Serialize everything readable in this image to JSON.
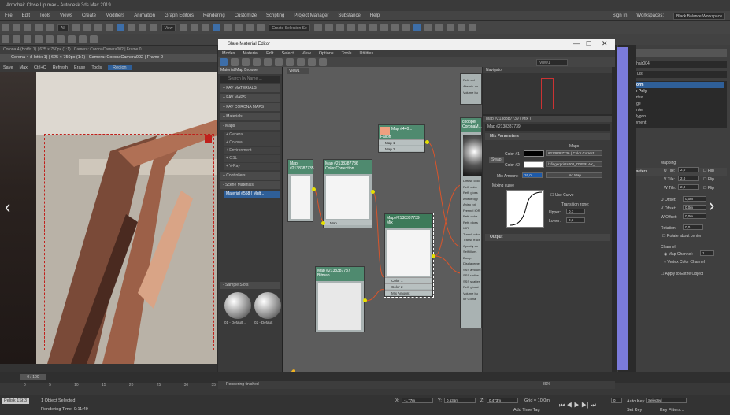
{
  "title": "Armchair Close Up.max - Autodesk 3ds Max 2019",
  "menu": [
    "File",
    "Edit",
    "Tools",
    "Views",
    "Create",
    "Modifiers",
    "Animation",
    "Graph Editors",
    "Rendering",
    "Customize",
    "Scripting",
    "Project Manager",
    "Substance",
    "Help"
  ],
  "signin": "Sign In",
  "workspace_label": "Workspaces:",
  "workspace_value": "Black Balance Workspace",
  "toolbar_all": "All",
  "toolbar_view": "View",
  "create_selection": "Create Selection Se",
  "vfb": {
    "header": "Corona 4 (Hotfix 1) | 625 × 750px (1:1) | Camera: CoronaCamera002 | Frame 0",
    "title": "Corona 4 (Hotfix 1) | 625 × 750px (1:1) | Camera: CoronaCamera002 | Frame 0",
    "save": "Save",
    "max": "Max",
    "ctrlc": "Ctrl+C",
    "refresh": "Refresh",
    "erase": "Erase",
    "tools": "Tools",
    "region": "Region"
  },
  "sme": {
    "title": "Slate Material Editor",
    "menu": [
      "Modes",
      "Material",
      "Edit",
      "Select",
      "View",
      "Options",
      "Tools",
      "Utilities"
    ],
    "view_dropdown": "View1",
    "browser_title": "Material/Map Browser",
    "search": "Search by Name ...",
    "categories": [
      "+ FAV MATERIALS",
      "+ FAV MAPS",
      "+ FAV CORONA MAPS",
      "+ Materials",
      "- Maps"
    ],
    "maps_sub": [
      "+ General",
      "+ Corona",
      "+ Environment",
      "+ OSL",
      "+ V-Ray"
    ],
    "controllers": "+ Controllers",
    "scene_materials": "- Scene Materials",
    "scene_item": "Material #558 ( Mult...",
    "sample_slots": "- Sample Slots",
    "slot1": "01 - Default ...",
    "slot2": "02 - Default",
    "canvas_tab": "View1",
    "rendering_finished": "Rendering finished",
    "zoom": "89%"
  },
  "nodes": {
    "n735": "Map #2138387735",
    "n736_title": "Map #2138387736",
    "n736_sub": "Color Correction",
    "n736_slot": "Map",
    "falloff_title": "Map #440...",
    "falloff_sub": "Falloff",
    "falloff_slots": [
      "Map 1",
      "Map 2"
    ],
    "mix_title": "Map #2138387739",
    "mix_sub": "Mix",
    "mix_slots": [
      "Color 1",
      "Color 2",
      "Mix Amount"
    ],
    "bitmap_title": "Map #2138387737",
    "bitmap_sub": "Bitmap",
    "corona_title": "coopper",
    "corona_sub": "CoronaM...",
    "corona_slots": [
      "Diffuse colo",
      "Refl. color",
      "Refl. gloss",
      "Anisotropy",
      "Aniso rot",
      "Fresnel IOR",
      "Refr. color",
      "Refr. gloss",
      "IOR",
      "Transl. color",
      "Transl. fracti",
      "Opacity co",
      "Self-illum.",
      "Bump",
      "Displaceme",
      "SSS amount",
      "SSS radius",
      "SSS scatter",
      "Refl. glossi",
      "Volume bu",
      "ior Coma"
    ],
    "top_slots": [
      "Refr. col",
      "Absorb. co",
      "Volume bu"
    ]
  },
  "navigator": "Navigator",
  "params": {
    "header": "Map #2138387739 ( Mix )",
    "subheader": "Map #2138387739",
    "mix_parameters": "Mix Parameters",
    "maps_label": "Maps",
    "color1_label": "Color #1",
    "color1_map": "#2138387736 ( Color Correct",
    "color2_label": "Color #2",
    "color2_map": "l:\\fingerprints002_OVERLAY_",
    "swap": "Swap",
    "mix_amount_label": "Mix Amount:",
    "mix_amount_value": "26,0",
    "no_map": "No Map",
    "mixing_curve": "Mixing curve",
    "use_curve": "Use Curve",
    "transition_zone": "Transition zone:",
    "upper_label": "Upper:",
    "upper_value": "0,7",
    "lower_label": "Lower:",
    "lower_value": "0,3",
    "output": "Output"
  },
  "rpanel": {
    "name": "Scoop chair004",
    "modifier_list": "Modifier List",
    "stack": [
      "UVW Xform",
      "Editable Poly",
      "Vertex",
      "Edge",
      "Border",
      "Polygon",
      "Element"
    ],
    "parameters": "Parameters",
    "mapping": "Mapping:",
    "u_tile_label": "U Tile:",
    "u_tile": "2,0",
    "v_tile_label": "V Tile:",
    "v_tile": "2,0",
    "w_tile_label": "W Tile:",
    "w_tile": "2,0",
    "flip": "Flip",
    "u_offset_label": "U Offset:",
    "u_offset": "0,0m",
    "v_offset_label": "V Offset:",
    "v_offset": "0,0m",
    "w_offset_label": "W Offset:",
    "w_offset": "0,0m",
    "rotation_label": "Rotation:",
    "rotation": "0,0",
    "rotate_center": "Rotate about center",
    "channel": "Channel:",
    "map_channel_label": "Map Channel:",
    "map_channel": "1",
    "vertex_color": "Vertex Color Channel",
    "apply_entire": "Apply to Entire Object"
  },
  "timeline": {
    "frame": "0 / 100",
    "ticks": [
      "0",
      "5",
      "10",
      "15",
      "20",
      "25",
      "30",
      "35",
      "40",
      "45",
      "50",
      "55",
      "60",
      "65",
      "70",
      "75",
      "80",
      "85",
      "90",
      "95",
      "100"
    ]
  },
  "bottom": {
    "script": "Pelisk 1St 3",
    "objects": "1 Object Selected",
    "render_time": "Rendering Time: 0:11:49",
    "x_label": "X:",
    "x": "-1,77m",
    "y_label": "Y:",
    "y": "0,536m",
    "z_label": "Z:",
    "z": "0,473m",
    "grid": "Grid = 10,0m",
    "add_time_tag": "Add Time Tag",
    "auto_key": "Auto Key",
    "selected": "Selected",
    "set_key": "Set Key",
    "key_filters": "Key Filters...",
    "frame_field": "0"
  }
}
